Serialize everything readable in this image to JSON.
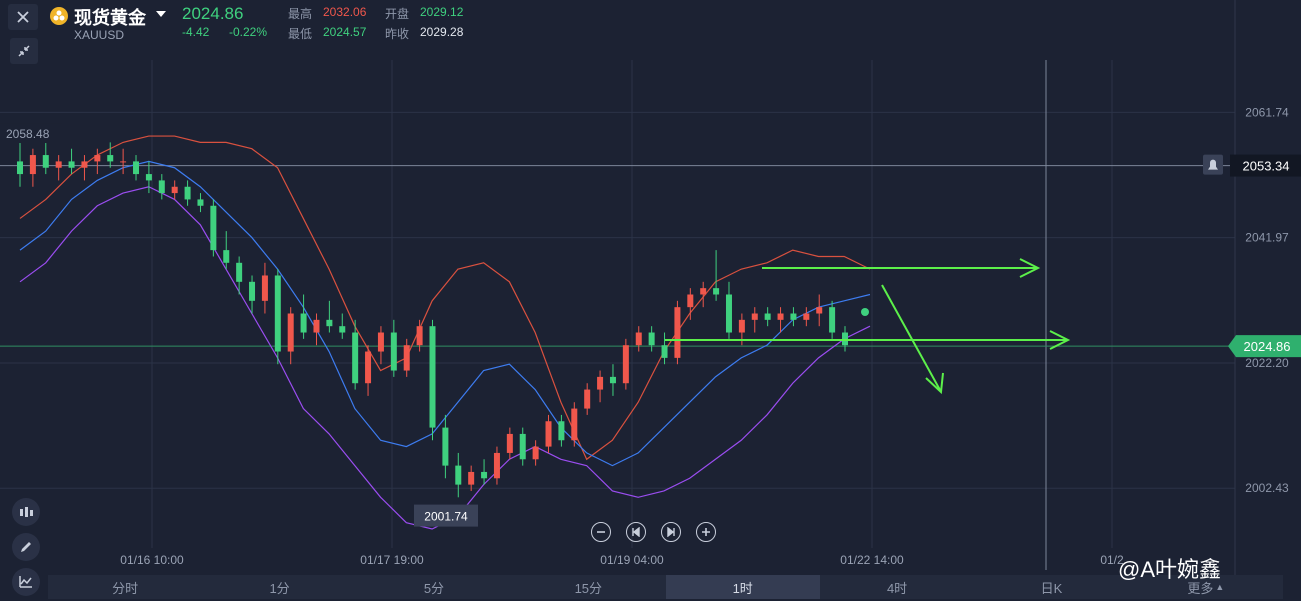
{
  "header": {
    "title": "现货黄金",
    "symbol": "XAUUSD",
    "price": "2024.86",
    "change": "-4.42",
    "change_pct": "-0.22%",
    "stats": {
      "high_label": "最高",
      "high_value": "2032.06",
      "open_label": "开盘",
      "open_value": "2029.12",
      "low_label": "最低",
      "low_value": "2024.57",
      "prev_label": "昨收",
      "prev_value": "2029.28"
    }
  },
  "colors": {
    "up": "#f0574c",
    "down": "#3fd17f",
    "upper_band": "#d9513f",
    "middle_band": "#3d7cf0",
    "lower_band": "#9a4df0",
    "annotation": "#5cf04a"
  },
  "tabs": [
    "分时",
    "1分",
    "5分",
    "15分",
    "1时",
    "4时",
    "日K",
    "更多"
  ],
  "active_tab": "1时",
  "watermark": "@A叶婉鑫",
  "chart_data": {
    "type": "candlestick",
    "ylim": [
      1993,
      2070
    ],
    "y_ticks": [
      "2061.74",
      "2041.97",
      "2022.20",
      "2002.43"
    ],
    "x_ticks": [
      "01/16 10:00",
      "01/17 19:00",
      "01/19 04:00",
      "01/22 14:00",
      "01/2"
    ],
    "crosshair_price": "2053.34",
    "current_price_label": "2024.86",
    "high_marker": "2058.48",
    "low_marker": "2001.74",
    "series": [
      {
        "name": "upper",
        "values": [
          2045,
          2048,
          2052,
          2055,
          2057,
          2058,
          2058,
          2057,
          2057,
          2056,
          2053,
          2045,
          2037,
          2028,
          2021,
          2023,
          2032,
          2037,
          2038,
          2035,
          2027,
          2016,
          2007,
          2010,
          2016,
          2024,
          2030,
          2035,
          2037,
          2038,
          2040,
          2039,
          2039,
          2037
        ]
      },
      {
        "name": "middle",
        "values": [
          2040,
          2043,
          2048,
          2051,
          2053,
          2054,
          2053,
          2050,
          2046,
          2042,
          2037,
          2031,
          2024,
          2015,
          2010,
          2009,
          2011,
          2016,
          2021,
          2022,
          2018,
          2012,
          2008,
          2006,
          2008,
          2012,
          2016,
          2020,
          2023,
          2025,
          2029,
          2031,
          2032,
          2033
        ]
      },
      {
        "name": "lower",
        "values": [
          2035,
          2038,
          2043,
          2047,
          2049,
          2050,
          2048,
          2044,
          2037,
          2030,
          2023,
          2015,
          2011,
          2006,
          2001,
          1997,
          1996,
          1998,
          2003,
          2007,
          2009,
          2007,
          2006,
          2002,
          2001,
          2002,
          2004,
          2007,
          2010,
          2014,
          2019,
          2023,
          2026,
          2028
        ]
      }
    ],
    "candles": [
      {
        "o": 2054,
        "h": 2058,
        "l": 2050,
        "c": 2052
      },
      {
        "o": 2052,
        "h": 2056,
        "l": 2050,
        "c": 2055
      },
      {
        "o": 2055,
        "h": 2057,
        "l": 2052,
        "c": 2053
      },
      {
        "o": 2053,
        "h": 2055,
        "l": 2051,
        "c": 2054
      },
      {
        "o": 2054,
        "h": 2056,
        "l": 2052,
        "c": 2053
      },
      {
        "o": 2053,
        "h": 2055,
        "l": 2051,
        "c": 2054
      },
      {
        "o": 2054,
        "h": 2056,
        "l": 2052,
        "c": 2055
      },
      {
        "o": 2055,
        "h": 2057,
        "l": 2053,
        "c": 2054
      },
      {
        "o": 2054,
        "h": 2056,
        "l": 2052,
        "c": 2054
      },
      {
        "o": 2054,
        "h": 2055,
        "l": 2051,
        "c": 2052
      },
      {
        "o": 2052,
        "h": 2054,
        "l": 2049,
        "c": 2051
      },
      {
        "o": 2051,
        "h": 2052,
        "l": 2048,
        "c": 2049
      },
      {
        "o": 2049,
        "h": 2051,
        "l": 2048,
        "c": 2050
      },
      {
        "o": 2050,
        "h": 2051,
        "l": 2047,
        "c": 2048
      },
      {
        "o": 2048,
        "h": 2049,
        "l": 2046,
        "c": 2047
      },
      {
        "o": 2047,
        "h": 2048,
        "l": 2039,
        "c": 2040
      },
      {
        "o": 2040,
        "h": 2043,
        "l": 2037,
        "c": 2038
      },
      {
        "o": 2038,
        "h": 2039,
        "l": 2033,
        "c": 2035
      },
      {
        "o": 2035,
        "h": 2036,
        "l": 2030,
        "c": 2032
      },
      {
        "o": 2032,
        "h": 2038,
        "l": 2030,
        "c": 2036
      },
      {
        "o": 2036,
        "h": 2037,
        "l": 2022,
        "c": 2024
      },
      {
        "o": 2024,
        "h": 2031,
        "l": 2022,
        "c": 2030
      },
      {
        "o": 2030,
        "h": 2033,
        "l": 2026,
        "c": 2027
      },
      {
        "o": 2027,
        "h": 2030,
        "l": 2025,
        "c": 2029
      },
      {
        "o": 2029,
        "h": 2032,
        "l": 2027,
        "c": 2028
      },
      {
        "o": 2028,
        "h": 2030,
        "l": 2026,
        "c": 2027
      },
      {
        "o": 2027,
        "h": 2029,
        "l": 2018,
        "c": 2019
      },
      {
        "o": 2019,
        "h": 2025,
        "l": 2017,
        "c": 2024
      },
      {
        "o": 2024,
        "h": 2028,
        "l": 2022,
        "c": 2027
      },
      {
        "o": 2027,
        "h": 2029,
        "l": 2020,
        "c": 2021
      },
      {
        "o": 2021,
        "h": 2026,
        "l": 2020,
        "c": 2025
      },
      {
        "o": 2025,
        "h": 2029,
        "l": 2024,
        "c": 2028
      },
      {
        "o": 2028,
        "h": 2029,
        "l": 2010,
        "c": 2012
      },
      {
        "o": 2012,
        "h": 2014,
        "l": 2004,
        "c": 2006
      },
      {
        "o": 2006,
        "h": 2008,
        "l": 2001,
        "c": 2003
      },
      {
        "o": 2003,
        "h": 2006,
        "l": 2002,
        "c": 2005
      },
      {
        "o": 2005,
        "h": 2007,
        "l": 2003,
        "c": 2004
      },
      {
        "o": 2004,
        "h": 2009,
        "l": 2003,
        "c": 2008
      },
      {
        "o": 2008,
        "h": 2012,
        "l": 2007,
        "c": 2011
      },
      {
        "o": 2011,
        "h": 2012,
        "l": 2006,
        "c": 2007
      },
      {
        "o": 2007,
        "h": 2010,
        "l": 2006,
        "c": 2009
      },
      {
        "o": 2009,
        "h": 2014,
        "l": 2008,
        "c": 2013
      },
      {
        "o": 2013,
        "h": 2014,
        "l": 2009,
        "c": 2010
      },
      {
        "o": 2010,
        "h": 2016,
        "l": 2009,
        "c": 2015
      },
      {
        "o": 2015,
        "h": 2019,
        "l": 2014,
        "c": 2018
      },
      {
        "o": 2018,
        "h": 2021,
        "l": 2016,
        "c": 2020
      },
      {
        "o": 2020,
        "h": 2022,
        "l": 2017,
        "c": 2019
      },
      {
        "o": 2019,
        "h": 2026,
        "l": 2018,
        "c": 2025
      },
      {
        "o": 2025,
        "h": 2028,
        "l": 2024,
        "c": 2027
      },
      {
        "o": 2027,
        "h": 2028,
        "l": 2024,
        "c": 2025
      },
      {
        "o": 2025,
        "h": 2027,
        "l": 2022,
        "c": 2023
      },
      {
        "o": 2023,
        "h": 2032,
        "l": 2022,
        "c": 2031
      },
      {
        "o": 2031,
        "h": 2034,
        "l": 2029,
        "c": 2033
      },
      {
        "o": 2033,
        "h": 2035,
        "l": 2031,
        "c": 2034
      },
      {
        "o": 2034,
        "h": 2040,
        "l": 2032,
        "c": 2033
      },
      {
        "o": 2033,
        "h": 2035,
        "l": 2026,
        "c": 2027
      },
      {
        "o": 2027,
        "h": 2030,
        "l": 2025,
        "c": 2029
      },
      {
        "o": 2029,
        "h": 2031,
        "l": 2027,
        "c": 2030
      },
      {
        "o": 2030,
        "h": 2031,
        "l": 2028,
        "c": 2029
      },
      {
        "o": 2029,
        "h": 2031,
        "l": 2027,
        "c": 2030
      },
      {
        "o": 2030,
        "h": 2031,
        "l": 2028,
        "c": 2029
      },
      {
        "o": 2029,
        "h": 2031,
        "l": 2028,
        "c": 2030
      },
      {
        "o": 2030,
        "h": 2033,
        "l": 2028,
        "c": 2031
      },
      {
        "o": 2031,
        "h": 2032,
        "l": 2026,
        "c": 2027
      },
      {
        "o": 2027,
        "h": 2028,
        "l": 2024,
        "c": 2025
      }
    ]
  }
}
